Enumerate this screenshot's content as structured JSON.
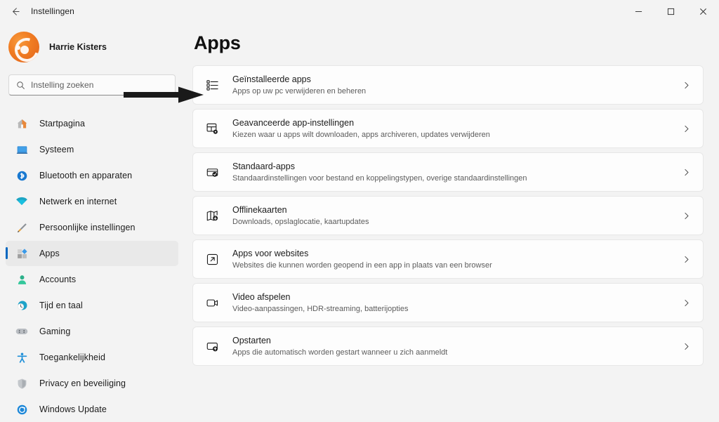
{
  "window": {
    "title": "Instellingen",
    "back_icon": "back-arrow-icon",
    "minimize_label": "—",
    "maximize_label": "□",
    "close_label": "✕"
  },
  "sidebar": {
    "profile": {
      "name": "Harrie Kisters",
      "avatar_icon": "user-avatar"
    },
    "search": {
      "placeholder": "Instelling zoeken",
      "icon": "search-icon"
    },
    "items": [
      {
        "label": "Startpagina",
        "icon": "home-icon",
        "active": false
      },
      {
        "label": "Systeem",
        "icon": "system-monitor-icon",
        "active": false
      },
      {
        "label": "Bluetooth en apparaten",
        "icon": "bluetooth-icon",
        "active": false
      },
      {
        "label": "Netwerk en internet",
        "icon": "wifi-icon",
        "active": false
      },
      {
        "label": "Persoonlijke instellingen",
        "icon": "paintbrush-icon",
        "active": false
      },
      {
        "label": "Apps",
        "icon": "apps-icon",
        "active": true
      },
      {
        "label": "Accounts",
        "icon": "person-icon",
        "active": false
      },
      {
        "label": "Tijd en taal",
        "icon": "clock-globe-icon",
        "active": false
      },
      {
        "label": "Gaming",
        "icon": "gamepad-icon",
        "active": false
      },
      {
        "label": "Toegankelijkheid",
        "icon": "accessibility-icon",
        "active": false
      },
      {
        "label": "Privacy en beveiliging",
        "icon": "shield-icon",
        "active": false
      },
      {
        "label": "Windows Update",
        "icon": "update-refresh-icon",
        "active": false
      }
    ]
  },
  "main": {
    "page_title": "Apps",
    "cards": [
      {
        "title": "Geïnstalleerde apps",
        "subtitle": "Apps op uw pc verwijderen en beheren",
        "icon": "installed-apps-list-icon",
        "chevron": "chevron-right-icon"
      },
      {
        "title": "Geavanceerde app-instellingen",
        "subtitle": "Kiezen waar u apps wilt downloaden, apps archiveren, updates verwijderen",
        "icon": "advanced-app-settings-icon",
        "chevron": "chevron-right-icon"
      },
      {
        "title": "Standaard-apps",
        "subtitle": "Standaardinstellingen voor bestand en koppelingstypen, overige standaardinstellingen",
        "icon": "default-apps-check-icon",
        "chevron": "chevron-right-icon"
      },
      {
        "title": "Offlinekaarten",
        "subtitle": "Downloads, opslaglocatie, kaartupdates",
        "icon": "offline-maps-icon",
        "chevron": "chevron-right-icon"
      },
      {
        "title": "Apps voor websites",
        "subtitle": "Websites die kunnen worden geopend in een app in plaats van een browser",
        "icon": "apps-for-websites-icon",
        "chevron": "chevron-right-icon"
      },
      {
        "title": "Video afspelen",
        "subtitle": "Video-aanpassingen, HDR-streaming, batterijopties",
        "icon": "video-playback-icon",
        "chevron": "chevron-right-icon"
      },
      {
        "title": "Opstarten",
        "subtitle": "Apps die automatisch worden gestart wanneer u zich aanmeldt",
        "icon": "startup-apps-icon",
        "chevron": "chevron-right-icon"
      }
    ]
  },
  "annotation": {
    "arrow_icon": "pointer-arrow-annotation",
    "color": "#1a1a1a"
  },
  "colors": {
    "accent": "#0067c0",
    "background": "#f3f3f3",
    "card": "#fdfdfd",
    "avatar_orange": "#ef7622"
  }
}
